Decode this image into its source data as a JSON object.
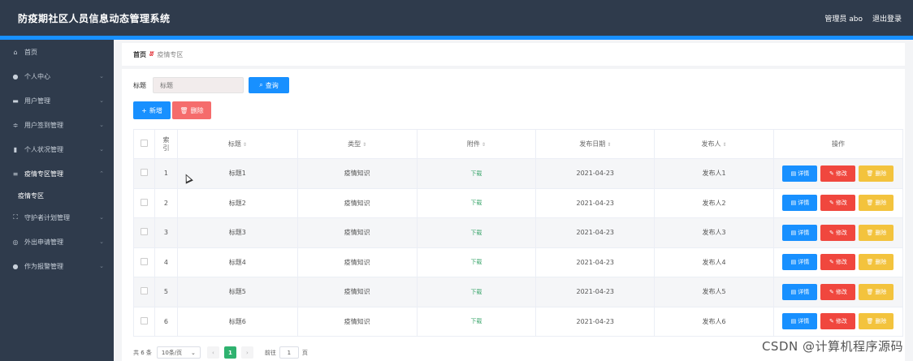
{
  "header": {
    "title": "防疫期社区人员信息动态管理系统",
    "user_label": "管理员 abo",
    "logout_label": "退出登录"
  },
  "sidebar": {
    "items": [
      {
        "label": "首页",
        "icon": "home-icon",
        "expandable": false
      },
      {
        "label": "个人中心",
        "icon": "user-icon",
        "expandable": true
      },
      {
        "label": "用户管理",
        "icon": "card-icon",
        "expandable": true
      },
      {
        "label": "用户签到管理",
        "icon": "sliders-icon",
        "expandable": true
      },
      {
        "label": "个人状况管理",
        "icon": "doc-icon",
        "expandable": true
      },
      {
        "label": "疫情专区管理",
        "icon": "menu-icon",
        "expandable": true,
        "expanded": true
      },
      {
        "label": "疫情专区",
        "icon": "",
        "expandable": false,
        "sub": true
      },
      {
        "label": "守护者计划管理",
        "icon": "frame-icon",
        "expandable": true
      },
      {
        "label": "外出申请管理",
        "icon": "location-icon",
        "expandable": true
      },
      {
        "label": "作为报警管理",
        "icon": "user-icon",
        "expandable": true
      }
    ]
  },
  "breadcrumb": {
    "home": "首页",
    "current": "疫情专区"
  },
  "search": {
    "label": "标题",
    "placeholder": "标题",
    "button_label": "查询"
  },
  "toolbar": {
    "add_label": "新增",
    "delete_label": "删除"
  },
  "table": {
    "headers": {
      "index": "索引",
      "title": "标题",
      "type": "类型",
      "attachment": "附件",
      "date": "发布日期",
      "publisher": "发布人",
      "actions": "操作"
    },
    "action_labels": {
      "detail": "详情",
      "edit": "修改",
      "remove": "删除"
    },
    "rows": [
      {
        "index": "1",
        "title": "标题1",
        "type": "疫情知识",
        "attachment": "下载",
        "date": "2021-04-23",
        "publisher": "发布人1"
      },
      {
        "index": "2",
        "title": "标题2",
        "type": "疫情知识",
        "attachment": "下载",
        "date": "2021-04-23",
        "publisher": "发布人2"
      },
      {
        "index": "3",
        "title": "标题3",
        "type": "疫情知识",
        "attachment": "下载",
        "date": "2021-04-23",
        "publisher": "发布人3"
      },
      {
        "index": "4",
        "title": "标题4",
        "type": "疫情知识",
        "attachment": "下载",
        "date": "2021-04-23",
        "publisher": "发布人4"
      },
      {
        "index": "5",
        "title": "标题5",
        "type": "疫情知识",
        "attachment": "下载",
        "date": "2021-04-23",
        "publisher": "发布人5"
      },
      {
        "index": "6",
        "title": "标题6",
        "type": "疫情知识",
        "attachment": "下载",
        "date": "2021-04-23",
        "publisher": "发布人6"
      }
    ]
  },
  "pagination": {
    "total_label": "共 6 条",
    "page_size": "10条/页",
    "current_page": "1",
    "goto_label": "前往",
    "goto_value": "1",
    "page_suffix": "页"
  },
  "watermark": "CSDN @计算机程序源码",
  "colors": {
    "header_bg": "#2f3b4c",
    "accent": "#1890ff",
    "danger": "#f56c6c",
    "warning": "#f3c33d",
    "success": "#2fb26f"
  }
}
